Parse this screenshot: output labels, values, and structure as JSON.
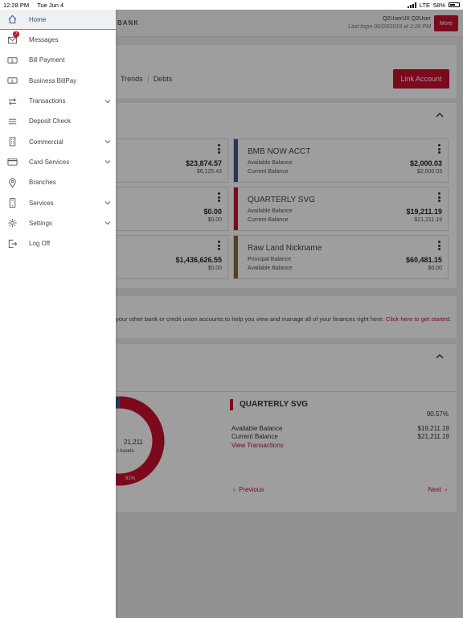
{
  "status_bar": {
    "time": "12:28 PM",
    "date": "Tue Jun 4",
    "network": "LTE",
    "battery": "58%",
    "battery_level": 0.58
  },
  "header": {
    "brand": "BANK",
    "user_name": "Q2UserUX Q2User",
    "last_login": "Last login 06/03/2019 at 2:26 PM",
    "more_label": "More"
  },
  "nav": [
    {
      "label": "Home",
      "icon": "home-icon",
      "active": true
    },
    {
      "label": "Messages",
      "icon": "envelope-icon",
      "badge": "7"
    },
    {
      "label": "Bill Payment",
      "icon": "bill-icon"
    },
    {
      "label": "Business BillPay",
      "icon": "bill-icon"
    },
    {
      "label": "Transactions",
      "icon": "transfer-arrows-icon",
      "expandable": true
    },
    {
      "label": "Deposit Check",
      "icon": "list-icon"
    },
    {
      "label": "Commercial",
      "icon": "building-icon",
      "expandable": true
    },
    {
      "label": "Card Services",
      "icon": "card-icon",
      "expandable": true
    },
    {
      "label": "Branches",
      "icon": "location-pin-icon"
    },
    {
      "label": "Services",
      "icon": "phone-icon",
      "expandable": true
    },
    {
      "label": "Settings",
      "icon": "gear-icon",
      "expandable": true
    },
    {
      "label": "Log Off",
      "icon": "logout-icon"
    }
  ],
  "toolbar": {
    "tabs": [
      "Trends",
      "Debts"
    ],
    "link_account_label": "Link Account"
  },
  "accounts": [
    {
      "name": "",
      "label1": "",
      "label2": "",
      "value1": "$23,874.57",
      "value2": "$6,125.43",
      "color": "#3b5d8a"
    },
    {
      "name": "BMB NOW ACCT",
      "label1": "Available Balance",
      "label2": "Current Balance",
      "value1": "$2,000.03",
      "value2": "$2,000.03",
      "color": "#3b5d8a"
    },
    {
      "name": "",
      "label1": "",
      "label2": "",
      "value1": "$0.00",
      "value2": "$0.00",
      "color": "#c8102e"
    },
    {
      "name": "QUARTERLY SVG",
      "label1": "Available Balance",
      "label2": "Current Balance",
      "value1": "$19,211.19",
      "value2": "$21,211.19",
      "color": "#c8102e"
    },
    {
      "name": "",
      "label1": "",
      "label2": "",
      "value1": "$1,436,626.55",
      "value2": "$0.00",
      "color": "#8a6a3b"
    },
    {
      "name": "Raw Land Nickname",
      "label1": "Principal Balance",
      "label2": "Available Balance",
      "value1": "$60,481.15",
      "value2": "$0.00",
      "color": "#8a6a3b"
    }
  ],
  "connect": {
    "text": "your other bank or credit union accounts to help you view and manage all of your finances right here.",
    "link": "Click here to get started."
  },
  "summary": {
    "donut_center": "21,211",
    "donut_sub": "l Assets",
    "donut_pct": "91%",
    "donut_fraction": 0.91,
    "accent": "#c8102e",
    "selected_name": "QUARTERLY SVG",
    "selected_pct": "90.57%",
    "available_label": "Available Balance",
    "available_value": "$19,211.19",
    "current_label": "Current Balance",
    "current_value": "$21,211.19",
    "view_transactions": "View Transactions",
    "previous": "Previous",
    "next": "Next"
  }
}
